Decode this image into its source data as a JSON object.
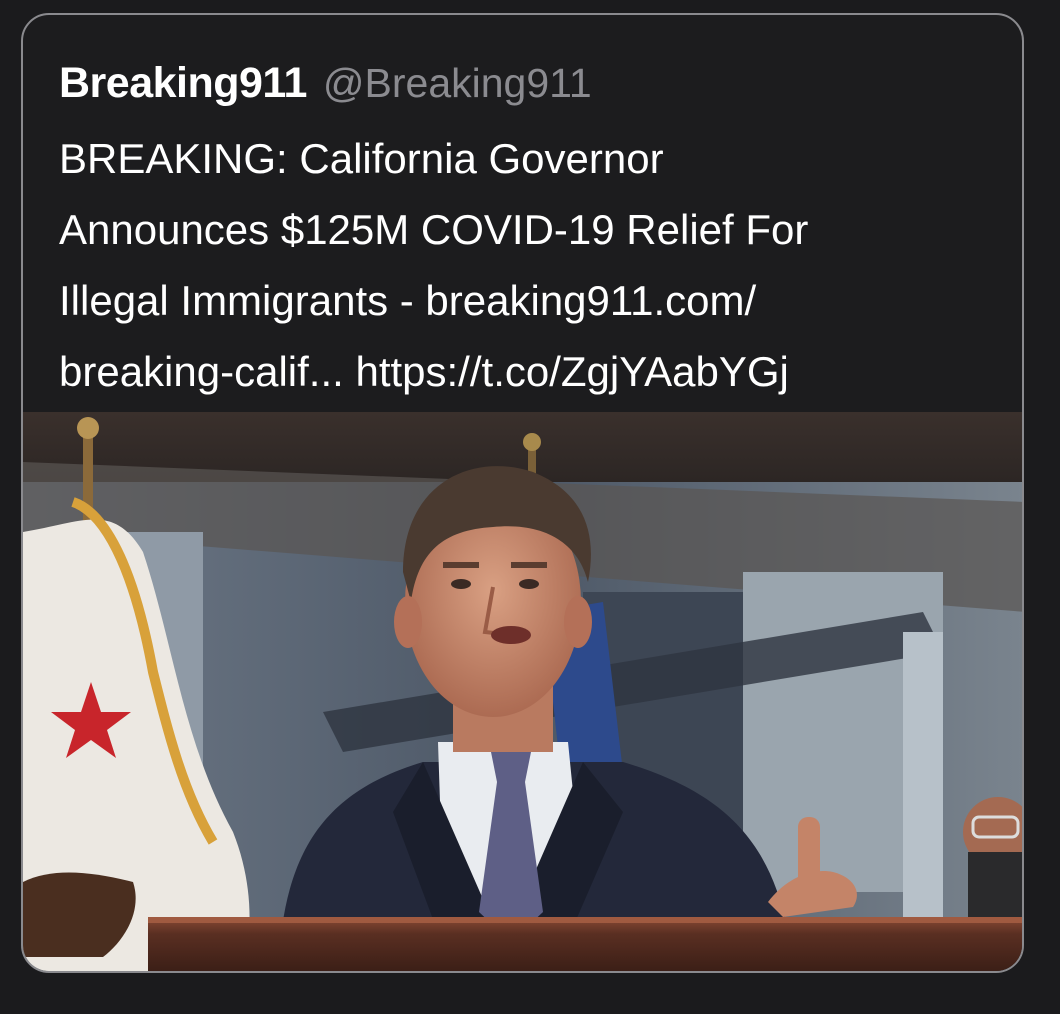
{
  "tweet": {
    "display_name": "Breaking911",
    "handle": "@Breaking911",
    "text_lines": [
      "BREAKING: California Governor",
      "Announces $125M COVID-19 Relief For",
      "Illegal Immigrants - breaking911.com/",
      "breaking-calif... https://t.co/ZgjYAabYGj"
    ]
  },
  "media": {
    "icon": "photo-image",
    "colors": {
      "flag_white": "#ece8e2",
      "flag_red_star": "#c8252b",
      "suit": "#23283a",
      "tie": "#5e5f86",
      "shirt": "#e9ecf0",
      "podium": "#5a2f22"
    }
  },
  "colors": {
    "background": "#1b1b1d",
    "card_border": "#8a8a8e",
    "text_primary": "#ffffff",
    "text_secondary": "#8b8b90"
  }
}
